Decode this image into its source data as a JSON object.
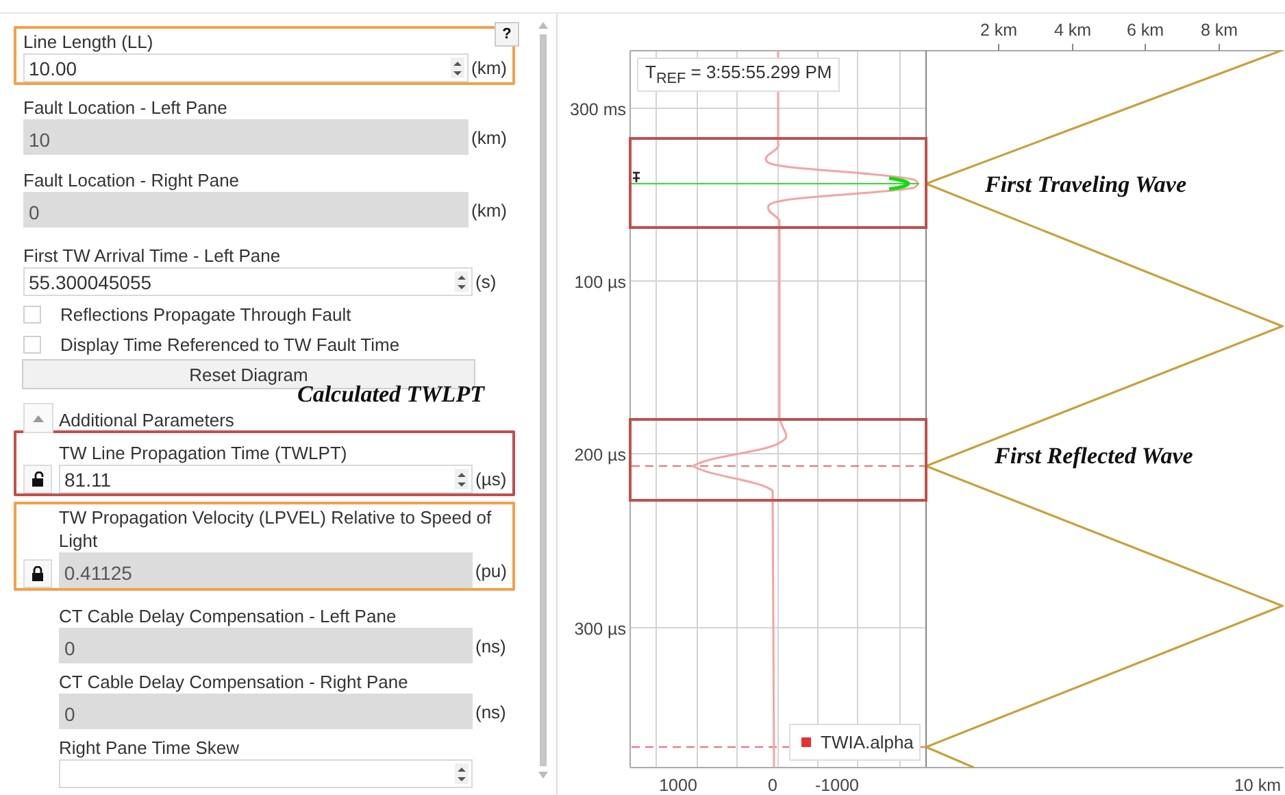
{
  "help_button": {
    "label": "?"
  },
  "sections": [
    {
      "items": [
        {
          "kind": "spin",
          "label": "Line Length (LL)",
          "value": "10.00",
          "unit": "(km)",
          "color": "#f5a04a"
        },
        {
          "kind": "readonly",
          "label": "Fault Location - Left Pane",
          "value": "10",
          "unit": "(km)"
        },
        {
          "kind": "readonly",
          "label": "Fault Location - Right Pane",
          "value": "0",
          "unit": "(km)"
        }
      ]
    },
    {
      "items": [
        {
          "kind": "spin",
          "label": "First TW Arrival Time - Left Pane",
          "value": "55.300045055",
          "unit": "(s)"
        },
        {
          "kind": "checkbox",
          "label": "Reflections Propagate Through Fault",
          "checked": false
        },
        {
          "kind": "checkbox",
          "label": "Display Time Referenced to TW Fault Time",
          "checked": false
        },
        {
          "kind": "button",
          "label": "Reset Diagram"
        }
      ]
    },
    {
      "items": [
        {
          "kind": "expander",
          "label": "Additional Parameters",
          "expanded": true,
          "annotation": "Calculated TWLPT",
          "children": [
            {
              "kind": "spin",
              "label": "TW Line Propagation Time (TWLPT)",
              "value": "81.11",
              "unit": "(µs)",
              "locked": false,
              "color": "#c0504d"
            },
            {
              "kind": "readonly",
              "label": "TW Propagation Velocity (LPVEL) Relative to Speed of Light",
              "value": "0.41125",
              "unit": "(pu)",
              "locked": true,
              "color": "#f5a04a"
            },
            {
              "kind": "readonly",
              "label": "CT Cable Delay Compensation - Left Pane",
              "value": "0",
              "unit": "(ns)"
            },
            {
              "kind": "readonly",
              "label": "CT Cable Delay Compensation - Right Pane",
              "value": "0",
              "unit": "(ns)"
            },
            {
              "kind": "spin",
              "label": "Right Pane Time Skew"
            }
          ]
        }
      ]
    }
  ],
  "chart": {
    "tref": "T$_{REF}$ = 3:55:55.299 PM",
    "time_ticks": [
      "300 ms",
      "100 µs",
      "200 µs",
      "300 µs"
    ],
    "amplitude_ticks": [
      "1000",
      "0",
      "-1000"
    ],
    "distance_ticks": [
      "2 km",
      "4 km",
      "6 km",
      "8 km",
      "10 km"
    ],
    "legend": {
      "label": "TWIA.alpha",
      "color": "#e83030"
    },
    "annotations": [
      "First Traveling Wave",
      "First Reflected Wave"
    ]
  }
}
